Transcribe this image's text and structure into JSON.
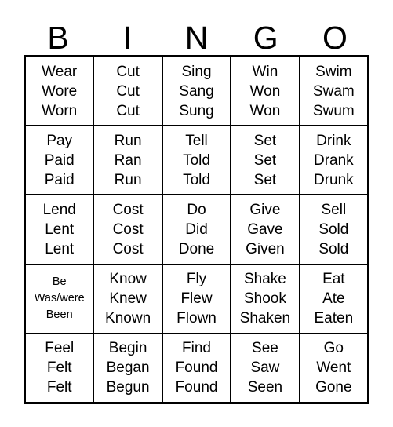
{
  "card": {
    "title": "BINGO",
    "columns": [
      "B",
      "I",
      "N",
      "G",
      "O"
    ],
    "text_color": "#000000",
    "background_color": "#ffffff",
    "border_color": "#000000",
    "rows": [
      {
        "cells": [
          {
            "lines": [
              "Wear",
              "Wore",
              "Worn"
            ],
            "small": false
          },
          {
            "lines": [
              "Cut",
              "Cut",
              "Cut"
            ],
            "small": false
          },
          {
            "lines": [
              "Sing",
              "Sang",
              "Sung"
            ],
            "small": false
          },
          {
            "lines": [
              "Win",
              "Won",
              "Won"
            ],
            "small": false
          },
          {
            "lines": [
              "Swim",
              "Swam",
              "Swum"
            ],
            "small": false
          }
        ]
      },
      {
        "cells": [
          {
            "lines": [
              "Pay",
              "Paid",
              "Paid"
            ],
            "small": false
          },
          {
            "lines": [
              "Run",
              "Ran",
              "Run"
            ],
            "small": false
          },
          {
            "lines": [
              "Tell",
              "Told",
              "Told"
            ],
            "small": false
          },
          {
            "lines": [
              "Set",
              "Set",
              "Set"
            ],
            "small": false
          },
          {
            "lines": [
              "Drink",
              "Drank",
              "Drunk"
            ],
            "small": false
          }
        ]
      },
      {
        "cells": [
          {
            "lines": [
              "Lend",
              "Lent",
              "Lent"
            ],
            "small": false
          },
          {
            "lines": [
              "Cost",
              "Cost",
              "Cost"
            ],
            "small": false
          },
          {
            "lines": [
              "Do",
              "Did",
              "Done"
            ],
            "small": false
          },
          {
            "lines": [
              "Give",
              "Gave",
              "Given"
            ],
            "small": false
          },
          {
            "lines": [
              "Sell",
              "Sold",
              "Sold"
            ],
            "small": false
          }
        ]
      },
      {
        "cells": [
          {
            "lines": [
              "Be",
              "Was/were",
              "Been"
            ],
            "small": true
          },
          {
            "lines": [
              "Know",
              "Knew",
              "Known"
            ],
            "small": false
          },
          {
            "lines": [
              "Fly",
              "Flew",
              "Flown"
            ],
            "small": false
          },
          {
            "lines": [
              "Shake",
              "Shook",
              "Shaken"
            ],
            "small": false
          },
          {
            "lines": [
              "Eat",
              "Ate",
              "Eaten"
            ],
            "small": false
          }
        ]
      },
      {
        "cells": [
          {
            "lines": [
              "Feel",
              "Felt",
              "Felt"
            ],
            "small": false
          },
          {
            "lines": [
              "Begin",
              "Began",
              "Begun"
            ],
            "small": false
          },
          {
            "lines": [
              "Find",
              "Found",
              "Found"
            ],
            "small": false
          },
          {
            "lines": [
              "See",
              "Saw",
              "Seen"
            ],
            "small": false
          },
          {
            "lines": [
              "Go",
              "Went",
              "Gone"
            ],
            "small": false
          }
        ]
      }
    ]
  }
}
